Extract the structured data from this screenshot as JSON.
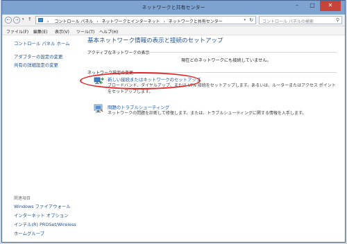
{
  "window": {
    "title": "ネットワークと共有センター",
    "minimize": "–",
    "maximize": "□",
    "close": "✕"
  },
  "addressbar": {
    "back_glyph": "←",
    "forward_glyph": "→",
    "drop_glyph": "▾",
    "up_glyph": "↑",
    "breadcrumbs": [
      "コントロール パネル",
      "ネットワークとインターネット",
      "ネットワークと共有センター"
    ],
    "separator": "›",
    "refresh_glyph": "↻",
    "search_placeholder": "コントロール パネルの検索",
    "search_glyph": "⚲"
  },
  "menu": {
    "items": [
      "ファイル(F)",
      "編集(E)",
      "表示(V)",
      "ツール(T)",
      "ヘルプ(H)"
    ]
  },
  "sidebar": {
    "top_links": [
      "コントロール パネル ホーム",
      "アダプターの設定の変更",
      "共有の詳細設定の変更"
    ],
    "related_heading": "関連項目",
    "related_links": [
      "Windows ファイアウォール",
      "インターネット オプション",
      "インテル(R) PROSet/Wireless",
      "ホームグループ"
    ]
  },
  "main": {
    "title": "基本ネットワーク情報の表示と接続のセットアップ",
    "active_networks_label": "アクティブなネットワークの表示",
    "no_network_text": "現在どのネットワークにも接続していません。",
    "change_settings_label": "ネットワーク設定の変更",
    "tasks": [
      {
        "link": "新しい接続またはネットワークのセットアップ",
        "desc": "ブロードバンド、ダイヤルアップ、または VPN 接続をセットアップします。あるいは、ルーターまたはアクセス ポイントをセットアップします。",
        "icon": "network-setup-icon"
      },
      {
        "link": "問題のトラブルシューティング",
        "desc": "ネットワークの問題を診断して修復します。または、トラブルシューティングに関する情報を入手します。",
        "icon": "troubleshoot-icon"
      }
    ]
  },
  "colors": {
    "link": "#1b55a8",
    "title": "#1e4f8f",
    "highlight": "#e32525",
    "titlebar": "#7fa3d1"
  }
}
